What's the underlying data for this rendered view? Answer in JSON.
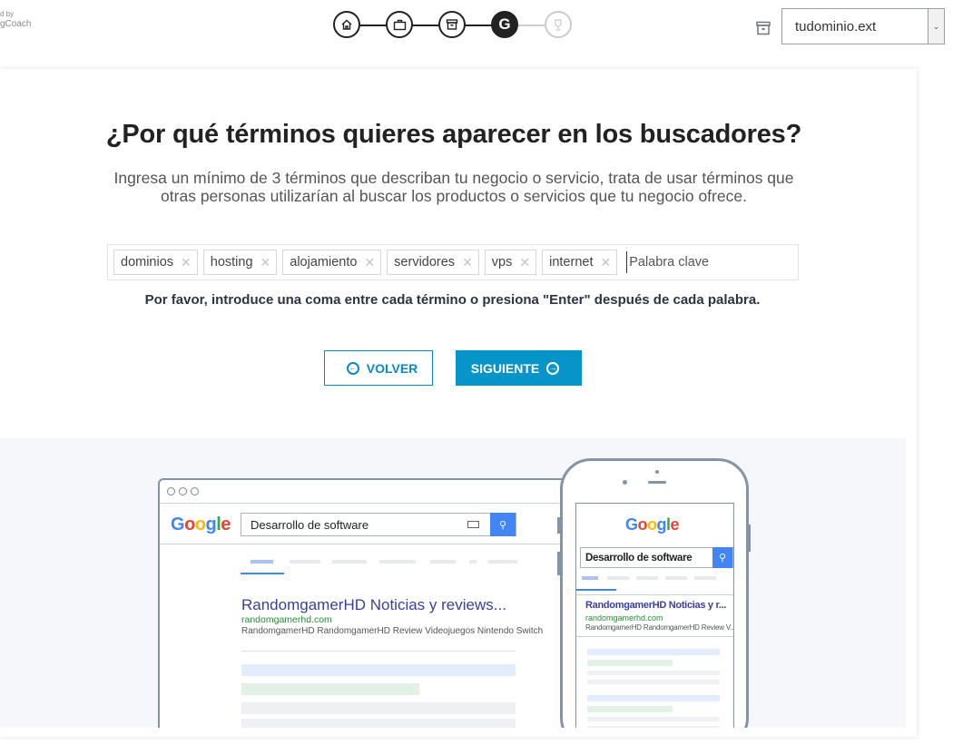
{
  "brand": {
    "line1": "d by",
    "line2": "gCoach"
  },
  "steps": [
    {
      "name": "home",
      "icon": "home-icon",
      "state": "done"
    },
    {
      "name": "briefcase",
      "icon": "briefcase-icon",
      "state": "done"
    },
    {
      "name": "archive",
      "icon": "archive-icon",
      "state": "done"
    },
    {
      "name": "google",
      "icon": "google-icon",
      "label": "G",
      "state": "active"
    },
    {
      "name": "trophy",
      "icon": "trophy-icon",
      "state": "pending"
    }
  ],
  "domain_select": {
    "value": "tudominio.ext"
  },
  "main": {
    "title": "¿Por qué términos quieres aparecer en los buscadores?",
    "subtitle": "Ingresa un mínimo de 3 términos que describan tu negocio o servicio, trata de usar términos que otras personas utilizarían al buscar los productos o servicios que tu negocio ofrece.",
    "tags": [
      "dominios",
      "hosting",
      "alojamiento",
      "servidores",
      "vps",
      "internet"
    ],
    "tag_remove": "✕",
    "tag_input_placeholder": "Palabra clave",
    "hint": "Por favor, introduce una coma entre cada término o presiona \"Enter\" después de cada palabra.",
    "back_label": "VOLVER",
    "next_label": "SIGUIENTE"
  },
  "illustration": {
    "logo": [
      "G",
      "o",
      "o",
      "g",
      "l",
      "e"
    ],
    "desktop_query": "Desarrollo de software",
    "desktop_result_title": "RandomgamerHD Noticias y reviews...",
    "desktop_result_url": "randomgamerhd.com",
    "desktop_result_desc": "RandomgamerHD RandomgamerHD Review Videojuegos Nintendo Switch",
    "mobile_query": "Desarrollo de software",
    "mobile_result_title": "RandomgamerHD Noticias y r...",
    "mobile_result_url": "randomgamerhd.com",
    "mobile_result_desc": "RandomgamerHD RandomgamerHD Review V..."
  },
  "colors": {
    "accent": "#0794c9",
    "step_active": "#222222",
    "step_pending": "#cccccc"
  }
}
